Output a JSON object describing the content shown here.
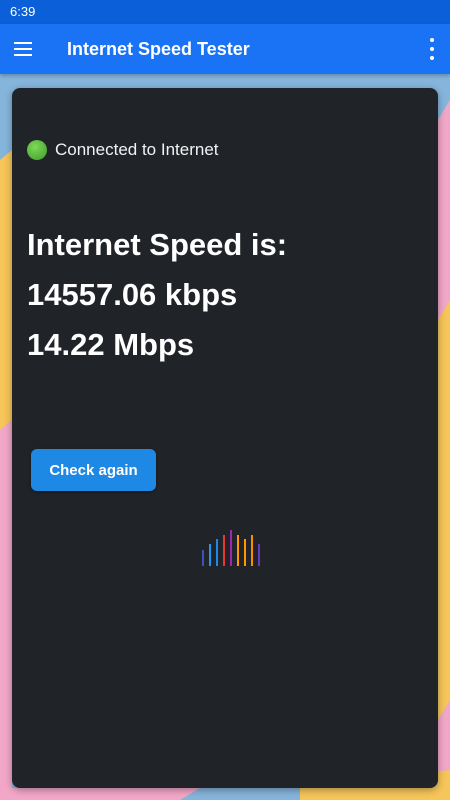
{
  "status_bar": {
    "time": "6:39"
  },
  "app_bar": {
    "title": "Internet Speed Tester",
    "menu_icon": "hamburger-menu-icon",
    "more_icon": "more-vert-icon"
  },
  "connection": {
    "status_text": "Connected to Internet",
    "indicator_color": "#4caf50"
  },
  "speed": {
    "heading": "Internet Speed is:",
    "kbps": "14557.06 kbps",
    "mbps": "14.22 Mbps"
  },
  "actions": {
    "check_again_label": "Check again"
  },
  "loader": {
    "bar_colors": [
      "#3f51b5",
      "#2196f3",
      "#1e88e5",
      "#e53935",
      "#9c27b0",
      "#ff9800",
      "#ff9800",
      "#fb8c00",
      "#673ab7"
    ],
    "bar_levels": [
      0.45,
      0.6,
      0.75,
      0.85,
      1.0,
      0.85,
      0.75,
      0.85,
      0.6
    ]
  },
  "colors": {
    "app_bar": "#1a73f5",
    "status_bar": "#0b5fd8",
    "card": "#202328",
    "button": "#1e88e5"
  }
}
